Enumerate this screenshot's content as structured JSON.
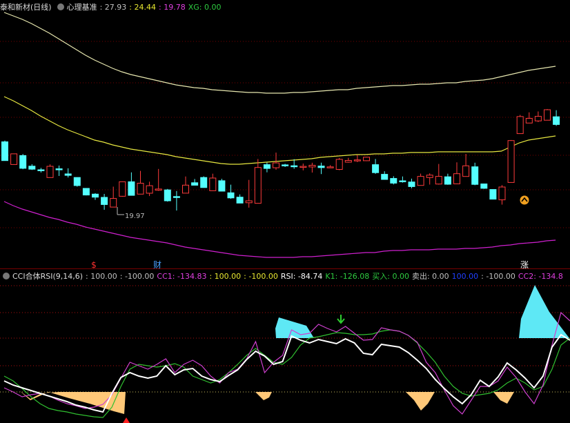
{
  "main": {
    "stock_name": "泰和新材(日线)",
    "indicator_name": "心理基准",
    "values": [
      {
        "label": ": 27.93",
        "color": "#c0c0c0"
      },
      {
        "label": ": 24.44",
        "color": "#e8e830"
      },
      {
        "label": ": 19.78",
        "color": "#e040e0"
      },
      {
        "label": "XG: 0.00",
        "color": "#2ecc40"
      }
    ],
    "min_price_label": "19.97",
    "markers": [
      {
        "text": "$",
        "color": "#ff3030"
      },
      {
        "text": "财",
        "color": "#4aa0ff"
      },
      {
        "text": "涨",
        "color": "#ffffff"
      }
    ]
  },
  "sub": {
    "indicator_name": "CCI合体RSI(9,14,6)",
    "values": [
      {
        "label": ": 100.00",
        "color": "#c0c0c0"
      },
      {
        "label": ": -100.00",
        "color": "#c0c0c0"
      },
      {
        "label": "CC1: -134.83",
        "color": "#e040e0"
      },
      {
        "label": ": 100.00",
        "color": "#e8e830"
      },
      {
        "label": ": -100.00",
        "color": "#e8e830"
      },
      {
        "label": "RSI: -84.74",
        "color": "#ffffff"
      },
      {
        "label": "K1: -126.08",
        "color": "#2ecc40"
      },
      {
        "label": "买入: 0.00",
        "color": "#2ecc40"
      },
      {
        "label": "卖出: 0.00",
        "color": "#c0c0c0"
      },
      {
        "label": "100.00",
        "color": "#2040ff"
      },
      {
        "label": ": -100.00",
        "color": "#c0c0c0"
      },
      {
        "label": "CC2: -134.8",
        "color": "#e040e0"
      }
    ]
  },
  "colors": {
    "up": "#ff3b3b",
    "down": "#54ffff",
    "upper_band": "#e8e8b0",
    "mid_band": "#e8e840",
    "lower_band": "#d020d0",
    "grid": "#7a0000"
  },
  "candles": [
    [
      205.5,
      232.7,
      203.7,
      232.7
    ],
    [
      238.4,
      222.9,
      222.9,
      238.4
    ],
    [
      225.4,
      243.9,
      223.2,
      245.2
    ],
    [
      240.8,
      245.2,
      238.0,
      246.3
    ],
    [
      246.0,
      246.0,
      243.3,
      250.0
    ],
    [
      257.3,
      241.0,
      238.3,
      257.3
    ],
    [
      244.6,
      244.6,
      239.9,
      255.0
    ],
    [
      252.0,
      254.1,
      243.9,
      257.2
    ],
    [
      257.2,
      268.9,
      257.2,
      270.5
    ],
    [
      273.0,
      282.6,
      272.6,
      283.2
    ],
    [
      281.3,
      285.7,
      280.0,
      289.6
    ],
    [
      286.0,
      296.4,
      281.0,
      304.0
    ],
    [
      300.1,
      287.6,
      270.5,
      300.1
    ],
    [
      284.4,
      263.4,
      262.9,
      285.1
    ],
    [
      263.4,
      283.1,
      249.8,
      283.1
    ],
    [
      281.3,
      265.5,
      247.6,
      281.3
    ],
    [
      280.0,
      269.1,
      263.3,
      284.1
    ],
    [
      275.6,
      273.9,
      244.8,
      276.6
    ],
    [
      275.2,
      291.0,
      273.8,
      292.2
    ],
    [
      284.8,
      285.3,
      276.8,
      305.1
    ],
    [
      279.9,
      268.3,
      255.7,
      279.9
    ],
    [
      264.8,
      268.4,
      259.4,
      268.6
    ],
    [
      257.2,
      271.8,
      255.5,
      271.8
    ],
    [
      276.4,
      258.0,
      251.7,
      276.4
    ],
    [
      261.9,
      277.0,
      259.1,
      277.0
    ],
    [
      279.4,
      286.8,
      267.6,
      288.1
    ],
    [
      285.7,
      294.3,
      281.7,
      294.5
    ],
    [
      293.8,
      291.0,
      260.7,
      300.9
    ],
    [
      294.6,
      242.7,
      230.4,
      294.6
    ],
    [
      238.6,
      244.1,
      235.6,
      249.7
    ],
    [
      243.1,
      236.1,
      221.1,
      246.0
    ],
    [
      238.9,
      240.2,
      237.4,
      242.0
    ],
    [
      240.2,
      240.2,
      230.7,
      244.6
    ],
    [
      241.9,
      241.1,
      237.0,
      246.9
    ],
    [
      241.9,
      239.5,
      235.8,
      250.1
    ],
    [
      240.6,
      242.9,
      235.8,
      252.3
    ],
    [
      242.6,
      241.8,
      239.3,
      243.3
    ],
    [
      245.5,
      230.9,
      228.9,
      246.6
    ],
    [
      235.0,
      232.5,
      228.7,
      235.7
    ],
    [
      232.1,
      231.7,
      224.7,
      234.9
    ],
    [
      232.9,
      227.8,
      227.3,
      233.4
    ],
    [
      238.6,
      250.2,
      230.4,
      251.9
    ],
    [
      252.6,
      260.0,
      248.2,
      260.0
    ],
    [
      258.6,
      265.4,
      255.4,
      267.3
    ],
    [
      262.0,
      262.6,
      255.7,
      264.7
    ],
    [
      263.7,
      270.4,
      258.9,
      272.9
    ],
    [
      268.7,
      255.6,
      251.6,
      268.7
    ],
    [
      257.3,
      253.8,
      251.2,
      267.5
    ],
    [
      266.7,
      255.6,
      237.6,
      267.5
    ],
    [
      256.2,
      267.0,
      251.7,
      267.8
    ],
    [
      266.4,
      251.7,
      235.2,
      266.8
    ],
    [
      255.7,
      240.3,
      223.0,
      255.7
    ],
    [
      241.7,
      267.2,
      235.8,
      268.4
    ],
    [
      266.5,
      272.9,
      266.5,
      273.7
    ],
    [
      274.6,
      288.6,
      274.6,
      288.6
    ],
    [
      289.6,
      271.0,
      268.2,
      296.5
    ],
    [
      264.4,
      203.7,
      202.9,
      264.4
    ],
    [
      193.6,
      168.9,
      166.5,
      193.6
    ],
    [
      178.3,
      171.5,
      162.8,
      178.3
    ],
    [
      175.2,
      168.6,
      161.5,
      176.9
    ],
    [
      174.2,
      159.0,
      158.0,
      174.2
    ],
    [
      169.2,
      180.4,
      159.7,
      182.4
    ]
  ],
  "upper_band": [
    18,
    23,
    28,
    34,
    41,
    48,
    56,
    64,
    72,
    80,
    87,
    93,
    99,
    104,
    108,
    111,
    114,
    117,
    120,
    123,
    125,
    127,
    128,
    130,
    131,
    132,
    133,
    134,
    134,
    135,
    135,
    135,
    134,
    134,
    133,
    132,
    131,
    130,
    130,
    128,
    127,
    126,
    125,
    124,
    124,
    123,
    122,
    122,
    121,
    120,
    120,
    118,
    117,
    116,
    114,
    111,
    108,
    105,
    102,
    100,
    98,
    96
  ],
  "mid_band": [
    140,
    146,
    153,
    160,
    168,
    175,
    182,
    188,
    193,
    198,
    203,
    206,
    210,
    213,
    216,
    218,
    220,
    222,
    224,
    227,
    229,
    231,
    233,
    235,
    237,
    238,
    238,
    237,
    236,
    235,
    234,
    233,
    232,
    231,
    230,
    228,
    227,
    226,
    225,
    224,
    224,
    223,
    223,
    222,
    222,
    221,
    221,
    221,
    220,
    220,
    220,
    220,
    220,
    220,
    220,
    219,
    213,
    207,
    203,
    201,
    199,
    197
  ],
  "lower_band": [
    292,
    298,
    303,
    307,
    311,
    315,
    318,
    322,
    325,
    329,
    332,
    335,
    338,
    341,
    344,
    346,
    348,
    350,
    352,
    355,
    358,
    360,
    362,
    364,
    366,
    368,
    370,
    371,
    372,
    373,
    373,
    373,
    373,
    372,
    372,
    371,
    370,
    369,
    368,
    367,
    366,
    366,
    364,
    363,
    363,
    362,
    362,
    362,
    361,
    361,
    361,
    360,
    360,
    359,
    358,
    356,
    355,
    353,
    352,
    351,
    349,
    348
  ],
  "magenta_line": [
    562,
    568,
    575,
    572,
    570,
    574,
    580,
    585,
    588,
    592,
    590,
    586,
    572,
    548,
    525,
    530,
    535,
    528,
    520,
    540,
    528,
    522,
    530,
    545,
    555,
    540,
    535,
    520,
    495,
    540,
    525,
    515,
    478,
    485,
    483,
    470,
    476,
    481,
    473,
    483,
    493,
    492,
    475,
    478,
    480,
    486,
    496,
    525,
    540,
    565,
    588,
    600,
    580,
    560,
    560,
    552,
    532,
    547,
    568,
    585,
    558,
    500,
    453,
    465
  ],
  "white_line": [
    552,
    558,
    562,
    566,
    570,
    574,
    578,
    582,
    587,
    590,
    594,
    597,
    570,
    547,
    540,
    545,
    548,
    545,
    530,
    543,
    536,
    534,
    545,
    550,
    553,
    544,
    536,
    521,
    509,
    516,
    528,
    524,
    487,
    493,
    497,
    492,
    495,
    498,
    491,
    497,
    512,
    514,
    499,
    501,
    503,
    511,
    522,
    534,
    550,
    563,
    575,
    585,
    572,
    551,
    560,
    546,
    526,
    536,
    548,
    562,
    545,
    503,
    485,
    493
  ],
  "green_line": [
    545,
    552,
    563,
    575,
    585,
    592,
    595,
    597,
    600,
    602,
    604,
    605,
    590,
    560,
    535,
    528,
    530,
    532,
    530,
    527,
    532,
    545,
    550,
    555,
    550,
    540,
    528,
    515,
    505,
    515,
    525,
    528,
    518,
    500,
    490,
    488,
    485,
    482,
    483,
    485,
    485,
    484,
    480,
    478,
    480,
    486,
    497,
    510,
    525,
    545,
    560,
    570,
    574,
    572,
    570,
    565,
    555,
    548,
    555,
    565,
    560,
    535,
    500,
    490
  ],
  "cci_top_fills": [
    [
      400,
      490,
      399,
      476,
      404,
      460,
      444,
      472,
      455,
      490
    ],
    [
      752,
      490,
      755,
      462,
      775,
      413,
      796,
      452,
      825,
      490
    ]
  ],
  "cci_bottom_fills": [
    [
      20,
      568,
      28,
      566,
      44,
      578,
      60,
      570,
      85,
      568,
      110,
      568,
      135,
      568,
      165,
      568,
      182,
      568,
      180,
      600,
      165,
      596,
      130,
      585,
      100,
      577,
      70,
      568,
      44,
      580,
      28,
      566
    ],
    [
      370,
      568,
      382,
      580,
      390,
      576,
      394,
      568
    ],
    [
      588,
      568,
      600,
      580,
      610,
      595,
      620,
      585,
      630,
      568
    ],
    [
      715,
      568,
      725,
      580,
      735,
      585,
      745,
      568
    ]
  ],
  "cci_hlines": [
    [
      0,
      414,
      "#b01010"
    ],
    [
      0,
      453,
      "#b01010"
    ],
    [
      0,
      490,
      "#b01010"
    ],
    [
      0,
      530,
      "#b01010"
    ],
    [
      0,
      568,
      "#d0c060"
    ]
  ]
}
